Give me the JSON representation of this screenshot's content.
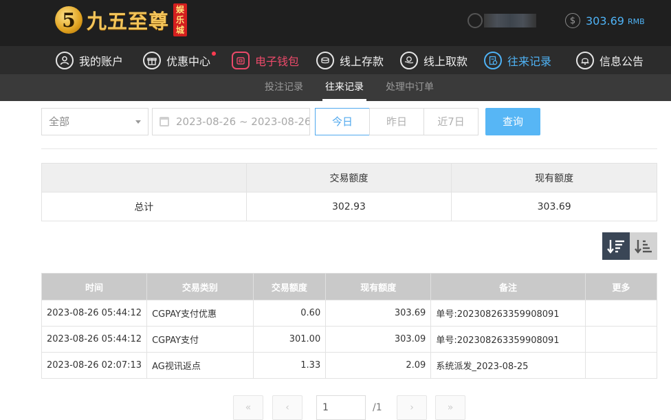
{
  "header": {
    "logo_mark": "5",
    "logo_text": "九五至尊",
    "logo_tag": "娱乐城",
    "balance_amount": "303.69",
    "balance_unit": "RMB"
  },
  "mainnav": [
    {
      "label": "我的账户",
      "icon": "user-icon"
    },
    {
      "label": "优惠中心",
      "icon": "gift-icon"
    },
    {
      "label": "电子钱包",
      "icon": "wallet-icon"
    },
    {
      "label": "线上存款",
      "icon": "deposit-icon"
    },
    {
      "label": "线上取款",
      "icon": "withdraw-icon"
    },
    {
      "label": "往来记录",
      "icon": "records-icon"
    },
    {
      "label": "信息公告",
      "icon": "bell-icon"
    }
  ],
  "subnav": [
    "投注记录",
    "往来记录",
    "处理中订单"
  ],
  "filters": {
    "type_value": "全部",
    "date_range": "2023-08-26 ~ 2023-08-26",
    "ranges": [
      "今日",
      "昨日",
      "近7日"
    ],
    "query_label": "查询"
  },
  "summary": {
    "headers": [
      "",
      "交易额度",
      "现有额度"
    ],
    "row_label": "总计",
    "trade_total": "302.93",
    "current_total": "303.69"
  },
  "records": {
    "headers": [
      "时间",
      "交易类别",
      "交易额度",
      "现有额度",
      "备注",
      "更多"
    ],
    "rows": [
      [
        "2023-08-26 05:44:12",
        "CGPAY支付优惠",
        "0.60",
        "303.69",
        "单号:202308263359908091",
        ""
      ],
      [
        "2023-08-26 05:44:12",
        "CGPAY支付",
        "301.00",
        "303.09",
        "单号:202308263359908091",
        ""
      ],
      [
        "2023-08-26 02:07:13",
        "AG视讯返点",
        "1.33",
        "2.09",
        "系统派发_2023-08-25",
        ""
      ]
    ]
  },
  "pagination": {
    "page": "1",
    "total": "/1"
  },
  "colors": {
    "accent": "#4fb3f6",
    "wallet": "#ec4a6a",
    "topbar": "#1f1f1f"
  }
}
